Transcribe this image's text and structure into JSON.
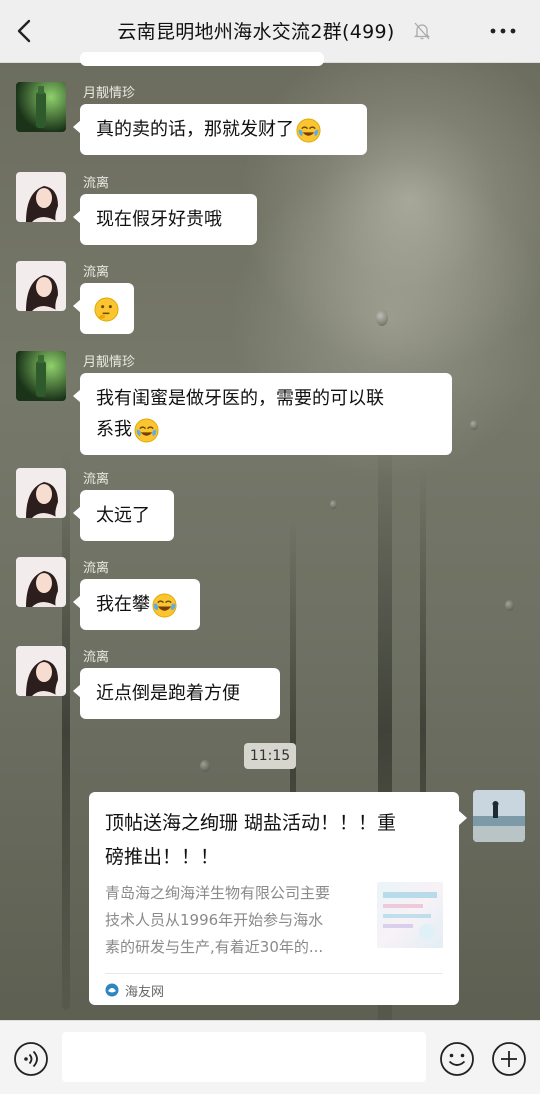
{
  "header": {
    "title": "云南昆明地州海水交流2群(499)",
    "back_icon": "chevron-left-icon",
    "mute_icon": "bell-off-icon",
    "more_icon": "more-horizontal-icon"
  },
  "messages": [
    {
      "sender": "月靓情珍",
      "text": "真的卖的话，那就发财了",
      "emoji": "crying-laughing-emoji",
      "avatar": "green-bottle-avatar"
    },
    {
      "sender": "流离",
      "text": "现在假牙好贵哦",
      "avatar": "girl-avatar"
    },
    {
      "sender": "流离",
      "text": "",
      "emoji": "thinking-emoji",
      "avatar": "girl-avatar"
    },
    {
      "sender": "月靓情珍",
      "line1": "我有闺蜜是做牙医的，需要的可以联",
      "line2": "系我",
      "emoji": "crying-laughing-emoji",
      "avatar": "green-bottle-avatar"
    },
    {
      "sender": "流离",
      "text": "太远了",
      "avatar": "girl-avatar"
    },
    {
      "sender": "流离",
      "text": "我在攀",
      "emoji": "tears-of-joy-emoji",
      "avatar": "girl-avatar"
    },
    {
      "sender": "流离",
      "text": "近点倒是跑着方便",
      "avatar": "girl-avatar"
    }
  ],
  "time_divider": "11:15",
  "link_card": {
    "title_line1": "顶帖送海之绚珊 瑚盐活动！！！重",
    "title_line2": "磅推出！！！",
    "desc_line1": "青岛海之绚海洋生物有限公司主要",
    "desc_line2": "技术人员从1996年开始参与海水",
    "desc_line3": "素的研发与生产,有着近30年的...",
    "source": "海友网",
    "source_icon": "site-logo-icon"
  },
  "input": {
    "value": "",
    "placeholder": ""
  },
  "bottombar": {
    "voice_icon": "voice-icon",
    "emoji_icon": "emoji-icon",
    "plus_icon": "plus-icon"
  },
  "colors": {
    "header_bg": "#efefef",
    "bubble_bg": "#ffffff",
    "sender_name": "#e9e9e2",
    "time_chip_bg": "#d6d6cf",
    "bottom_bar_bg": "#f4f4f4"
  }
}
